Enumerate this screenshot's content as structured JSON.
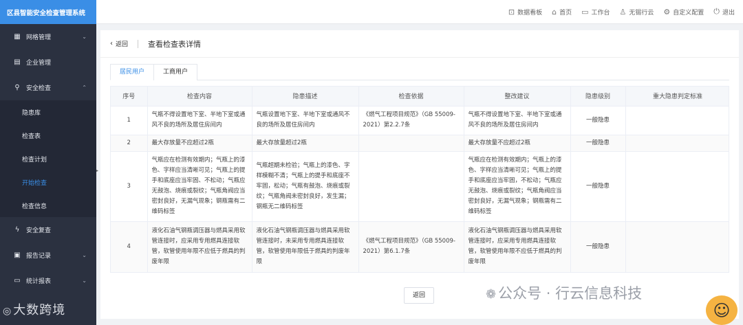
{
  "app": {
    "title": "区县智能安全检查管理系统"
  },
  "sidebar": {
    "items": [
      {
        "label": "网格管理",
        "icon": "grid-icon",
        "expandable": true
      },
      {
        "label": "企业管理",
        "icon": "building-icon",
        "expandable": false
      },
      {
        "label": "安全检查",
        "icon": "inspector-icon",
        "expandable": true,
        "expanded": true,
        "children": [
          "隐患库",
          "检查表",
          "检查计划",
          "开始检查",
          "检查信息"
        ],
        "active_child": "开始检查"
      },
      {
        "label": "安全复查",
        "icon": "lightning-icon",
        "expandable": false
      },
      {
        "label": "报告记录",
        "icon": "report-icon",
        "expandable": true
      },
      {
        "label": "统计报表",
        "icon": "monitor-icon",
        "expandable": true
      }
    ]
  },
  "topbar": {
    "links": [
      {
        "label": "数据看板",
        "icon": "dashboard-icon"
      },
      {
        "label": "首页",
        "icon": "home-icon"
      },
      {
        "label": "工作台",
        "icon": "desktop-icon"
      },
      {
        "label": "无锡行云",
        "icon": "user-icon"
      },
      {
        "label": "自定义配置",
        "icon": "gear-icon"
      },
      {
        "label": "退出",
        "icon": "power-icon"
      }
    ]
  },
  "page": {
    "back_label": "返回",
    "title": "查看检查表详情",
    "tabs": [
      "居民用户",
      "工商用户"
    ],
    "active_tab": "居民用户",
    "bottom_back_label": "返回"
  },
  "table": {
    "headers": [
      "序号",
      "检查内容",
      "隐患描述",
      "检查依据",
      "整改建议",
      "隐患级别",
      "重大隐患判定标准"
    ],
    "rows": [
      [
        "1",
        "气瓶不得设置地下室、半地下室或通风不良的场所及居住房间内",
        "气瓶设置地下室、半地下室或通风不良的场所及居住房间内",
        "《燃气工程项目规范》（GB 55009-2021）第2.2.7条",
        "气瓶不得设置地下室、半地下室或通风不良的场所及居住房间内",
        "一般隐患",
        ""
      ],
      [
        "2",
        "最大存放量不应超过2瓶",
        "最大存放量超过2瓶",
        "",
        "最大存放量不应超过2瓶",
        "一般隐患",
        ""
      ],
      [
        "3",
        "气瓶应在检测有效期内；气瓶上的漆色、字样应当清晰可见；气瓶上的提手和底座应当牢固、不松动；气瓶应无鼓泡、烧痕或裂纹；气瓶角阀应当密封良好，无漏气现象；钢瓶需有二维码标签",
        "气瓶超期未检验；气瓶上的漆色、字样模糊不清；气瓶上的提手和底座不牢固，松动；气瓶有鼓泡、烧痕或裂纹；气瓶角阀未密封良好，发生漏；钢瓶无二维码标签",
        "",
        "气瓶应在检测有效期内；气瓶上的漆色、字样应当清晰可见；气瓶上的提手和底座应当牢固，不松动；气瓶应无鼓泡、烧痕或裂纹；气瓶角阀应当密封良好，无漏气现象；钢瓶需有二维码标签",
        "一般隐患",
        ""
      ],
      [
        "4",
        "液化石油气钢瓶调压器与燃具采用软管连接时，应采用专用燃具连接软管，软管使用年限不应低于燃具的判废年限",
        "液化石油气钢瓶调压器与燃具采用软管连接时，未采用专用燃具连接软管，软管使用年限低于燃具的判废年限",
        "《燃气工程项目规范》（GB 55009-2021）第6.1.7条",
        "液化石油气钢瓶调压器与燃具采用软管连接时，应采用专用燃具连接软管，软管使用年限不应低于燃具的判废年限",
        "一般隐患",
        ""
      ]
    ]
  },
  "watermarks": {
    "left": "大数跨境",
    "right": "公众号 · 行云信息科技"
  },
  "colors": {
    "primary": "#3a8ee6",
    "sidebar": "#2b3140"
  }
}
